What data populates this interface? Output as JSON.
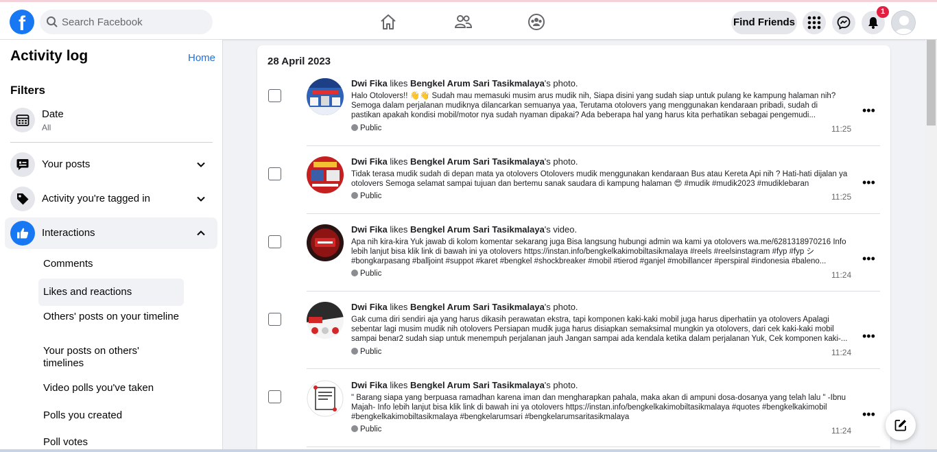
{
  "header": {
    "logo": "f",
    "search_placeholder": "Search Facebook",
    "find_friends": "Find Friends",
    "notification_count": "1"
  },
  "sidebar": {
    "title": "Activity log",
    "home_link": "Home",
    "filters_title": "Filters",
    "date": {
      "label": "Date",
      "value": "All"
    },
    "categories": [
      {
        "label": "Your posts"
      },
      {
        "label": "Activity you're tagged in"
      },
      {
        "label": "Interactions"
      }
    ],
    "interactions_sub": [
      "Comments",
      "Likes and reactions",
      "Others' posts on your timeline",
      "Your posts on others' timelines",
      "Video polls you've taken",
      "Polls you created",
      "Poll votes"
    ]
  },
  "main": {
    "date_header": "28 April 2023",
    "items": [
      {
        "actor": "Dwi Fika",
        "verb": " likes ",
        "target": "Bengkel Arum Sari Tasikmalaya",
        "suffix": "'s photo.",
        "description": "Halo Otolovers!! 👋👋 Sudah mau memasuki musim arus mudik nih, Siapa disini yang sudah siap untuk pulang ke kampung halaman nih? Semoga dalam perjalanan mudiknya dilancarkan semuanya yaa, Terutama otolovers yang menggunakan kendaraan pribadi, sudah di pastikan apakah kondisi mobil/motor nya sudah nyaman dipakai? Ada beberapa hal yang harus kita perhatikan sebagai pengemudi...",
        "privacy": "Public",
        "time": "11:25"
      },
      {
        "actor": "Dwi Fika",
        "verb": " likes ",
        "target": "Bengkel Arum Sari Tasikmalaya",
        "suffix": "'s photo.",
        "description": "Tidak terasa mudik sudah di depan mata ya otolovers Otolovers mudik menggunakan kendaraan Bus atau Kereta Api nih ? Hati-hati dijalan ya otolovers Semoga selamat sampai tujuan dan bertemu sanak saudara di kampung halaman 😍 #mudik #mudik2023 #mudiklebaran",
        "privacy": "Public",
        "time": "11:25"
      },
      {
        "actor": "Dwi Fika",
        "verb": " likes ",
        "target": "Bengkel Arum Sari Tasikmalaya",
        "suffix": "'s video.",
        "description": "Apa nih kira-kira Yuk jawab di kolom komentar sekarang juga Bisa langsung hubungi admin wa kami ya otolovers wa.me/6281318970216 Info lebih lanjut bisa klik link di bawah ini ya otolovers https://instan.info/bengkelkakimobiltasikmalaya #reels #reelsinstagram #fyp #fyp シ #bongkarpasang #balljoint #suppot #karet #bengkel #shockbreaker #mobil #tierod #ganjel #mobillancer #perspiral #indonesia #baleno...",
        "privacy": "Public",
        "time": "11:24"
      },
      {
        "actor": "Dwi Fika",
        "verb": " likes ",
        "target": "Bengkel Arum Sari Tasikmalaya",
        "suffix": "'s photo.",
        "description": "Gak cuma diri sendiri aja yang harus dikasih perawatan ekstra, tapi komponen kaki-kaki mobil juga harus diperhatiin ya otolovers Apalagi sebentar lagi musim mudik nih otolovers Persiapan mudik juga harus disiapkan semaksimal mungkin ya otolovers, dari cek kaki-kaki mobil sampai benar2 sudah siap untuk menempuh perjalanan jauh Jangan sampai ada kendala ketika dalam perjalanan Yuk, Cek komponen kaki-...",
        "privacy": "Public",
        "time": "11:24"
      },
      {
        "actor": "Dwi Fika",
        "verb": " likes ",
        "target": "Bengkel Arum Sari Tasikmalaya",
        "suffix": "'s photo.",
        "description": "\" Barang siapa yang berpuasa ramadhan karena iman dan mengharapkan pahala, maka akan di ampuni dosa-dosanya yang telah lalu \" -Ibnu Majah- Info lebih lanjut bisa klik link di bawah ini ya otolovers https://instan.info/bengkelkakimobiltasikmalaya #quotes #bengkelkakimobil #bengkelkakimobiltasikmalaya #bengkelarumsari #bengkelarumsaritasikmalaya",
        "privacy": "Public",
        "time": "11:24"
      }
    ]
  }
}
